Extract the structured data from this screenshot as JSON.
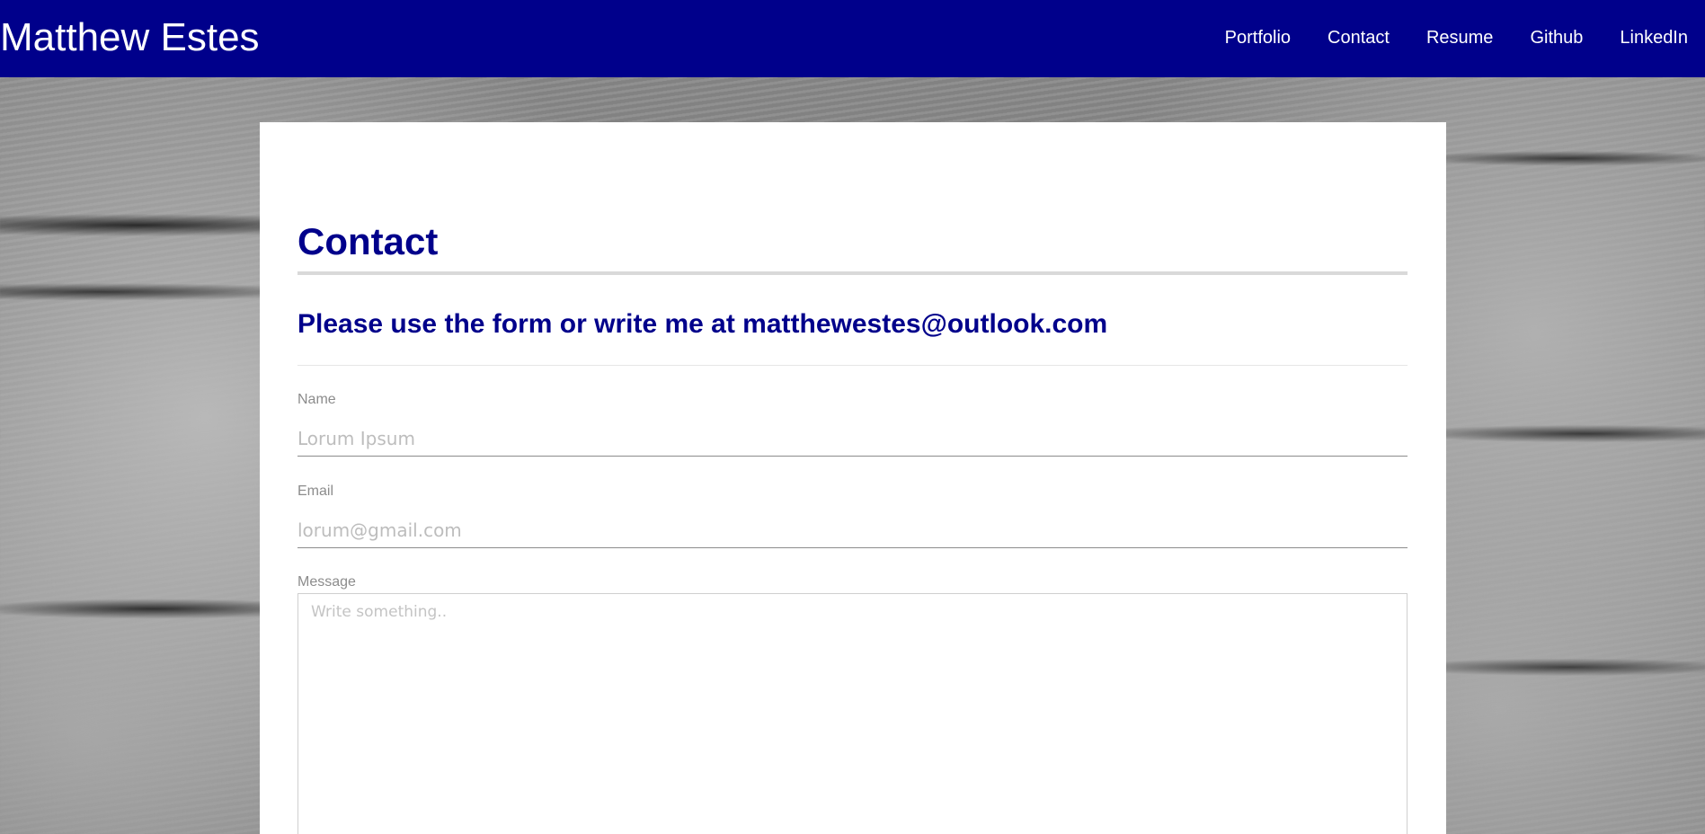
{
  "header": {
    "brand": "Matthew Estes",
    "nav": [
      {
        "label": "Portfolio"
      },
      {
        "label": "Contact"
      },
      {
        "label": "Resume"
      },
      {
        "label": "Github"
      },
      {
        "label": "LinkedIn"
      }
    ]
  },
  "main": {
    "title": "Contact",
    "subtitle": "Please use the form or write me at matthewestes@outlook.com",
    "form": {
      "name": {
        "label": "Name",
        "placeholder": "Lorum Ipsum",
        "value": ""
      },
      "email": {
        "label": "Email",
        "placeholder": "lorum@gmail.com",
        "value": ""
      },
      "message": {
        "label": "Message",
        "placeholder": "Write something..",
        "value": ""
      }
    }
  },
  "colors": {
    "navbar_bg": "#00008b",
    "heading": "#00008b",
    "label": "#8c8c8c"
  }
}
